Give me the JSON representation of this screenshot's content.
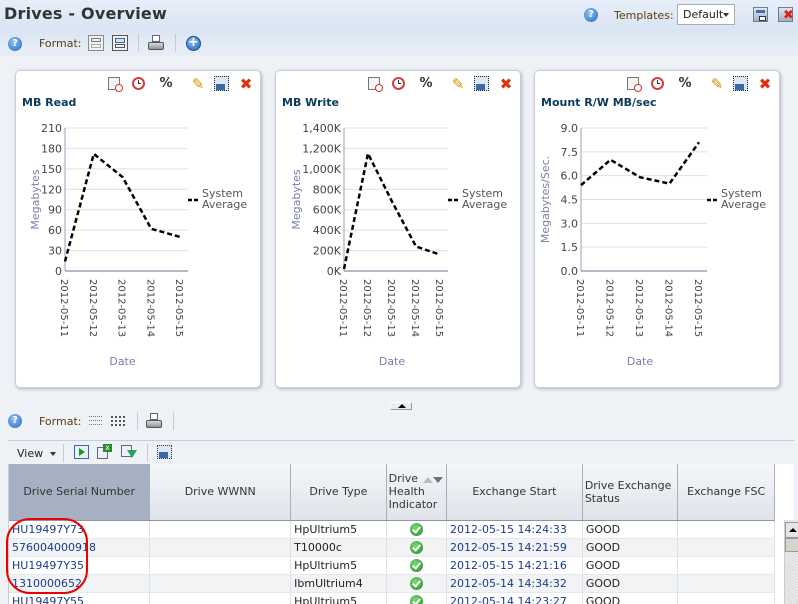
{
  "header": {
    "title": "Drives - Overview",
    "templates_label": "Templates:",
    "templates_value": "Default",
    "icons": [
      "help-icon",
      "save-template-icon",
      "delete-template-icon"
    ]
  },
  "toolbar": {
    "format_label": "Format:",
    "icons": [
      "help-icon",
      "grid-layout-icon",
      "single-layout-icon",
      "print-icon",
      "add-icon"
    ]
  },
  "panel_tools": [
    "date-range-icon",
    "clock-icon",
    "percent-icon",
    "edit-icon",
    "detach-icon",
    "close-icon"
  ],
  "charts": [
    {
      "title": "MB Read"
    },
    {
      "title": "MB Write"
    },
    {
      "title": "Mount R/W MB/sec"
    }
  ],
  "chart_data": [
    {
      "type": "line",
      "title": "MB Read",
      "xlabel": "Date",
      "ylabel": "Megabytes",
      "x": [
        "2012-05-11",
        "2012-05-12",
        "2012-05-13",
        "2012-05-14",
        "2012-05-15"
      ],
      "yticks": [
        "0",
        "30",
        "60",
        "90",
        "120",
        "150",
        "180",
        "210"
      ],
      "ylim": [
        0,
        210
      ],
      "grid": true,
      "legend": "right",
      "series": [
        {
          "name": "System Average",
          "values": [
            14,
            172,
            138,
            62,
            50
          ],
          "style": "dashed",
          "color": "#000000"
        }
      ]
    },
    {
      "type": "line",
      "title": "MB Write",
      "xlabel": "Date",
      "ylabel": "Megabytes",
      "x": [
        "2012-05-11",
        "2012-05-12",
        "2012-05-13",
        "2012-05-14",
        "2012-05-15"
      ],
      "yticks": [
        "0K",
        "200K",
        "400K",
        "600K",
        "800K",
        "1,000K",
        "1,200K",
        "1,400K"
      ],
      "ylim": [
        0,
        1400
      ],
      "grid": true,
      "legend": "right",
      "series": [
        {
          "name": "System Average",
          "values": [
            20,
            1150,
            680,
            240,
            160
          ],
          "style": "dashed",
          "color": "#000000"
        }
      ]
    },
    {
      "type": "line",
      "title": "Mount R/W MB/sec",
      "xlabel": "Date",
      "ylabel": "Megabytes/Sec.",
      "x": [
        "2012-05-11",
        "2012-05-12",
        "2012-05-13",
        "2012-05-14",
        "2012-05-15"
      ],
      "yticks": [
        "0.0",
        "1.5",
        "3.0",
        "4.5",
        "6.0",
        "7.5",
        "9.0"
      ],
      "ylim": [
        0,
        9
      ],
      "grid": true,
      "legend": "right",
      "series": [
        {
          "name": "System Average",
          "values": [
            5.4,
            7.0,
            5.9,
            5.5,
            8.1
          ],
          "style": "dashed",
          "color": "#000000"
        }
      ]
    }
  ],
  "legend_label_line1": "System",
  "legend_label_line2": "Average",
  "table_section": {
    "format_label": "Format:",
    "view_label": "View",
    "columns": [
      "Drive Serial Number",
      "Drive WWNN",
      "Drive Type",
      "Drive Health Indicator",
      "Exchange Start",
      "Drive Exchange Status",
      "Exchange FSC"
    ],
    "rows": [
      {
        "serial": "HU19497Y73",
        "wwnn": "",
        "type": "HpUltrium5",
        "health": "ok",
        "start": "2012-05-15 14:24:33",
        "status": "GOOD",
        "fsc": ""
      },
      {
        "serial": "576004000918",
        "wwnn": "",
        "type": "T10000c",
        "health": "ok",
        "start": "2012-05-15 14:21:59",
        "status": "GOOD",
        "fsc": ""
      },
      {
        "serial": "HU19497Y35",
        "wwnn": "",
        "type": "HpUltrium5",
        "health": "ok",
        "start": "2012-05-15 14:21:16",
        "status": "GOOD",
        "fsc": ""
      },
      {
        "serial": "1310000652",
        "wwnn": "",
        "type": "IbmUltrium4",
        "health": "ok",
        "start": "2012-05-14 14:34:32",
        "status": "GOOD",
        "fsc": ""
      },
      {
        "serial": "HU19497Y55",
        "wwnn": "",
        "type": "HpUltrium5",
        "health": "ok",
        "start": "2012-05-14 14:23:27",
        "status": "GOOD",
        "fsc": ""
      }
    ]
  },
  "colors": {
    "link": "#1a3c8c",
    "title": "#0b3a5c",
    "highlight": "#ee0000",
    "sorted_header": "#a5b1c2"
  }
}
